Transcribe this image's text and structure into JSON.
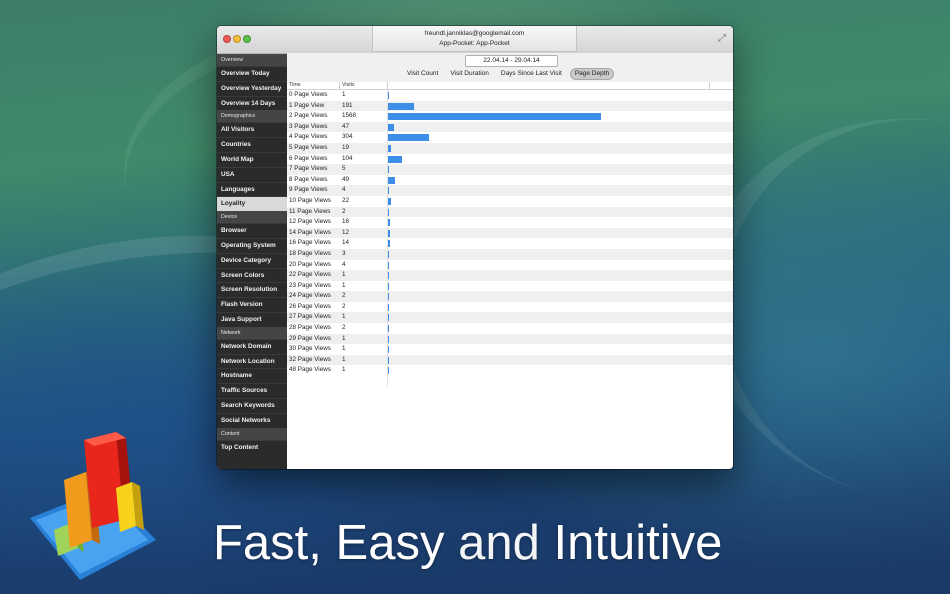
{
  "window": {
    "account": "freundt.janniklas@googlemail.com",
    "app": "App-Pocket: App-Pocket"
  },
  "sidebar": {
    "sections": [
      {
        "title": "Overview",
        "items": [
          "Overview Today",
          "Overview Yesterday",
          "Overview 14 Days"
        ]
      },
      {
        "title": "Demographics",
        "items": [
          "All Visitors",
          "Countries",
          "World Map",
          "USA",
          "Languages",
          "Loyality"
        ]
      },
      {
        "title": "Device",
        "items": [
          "Browser",
          "Operating System",
          "Device Category",
          "Screen Colors",
          "Screen Resolution",
          "Flash Version",
          "Java Support"
        ]
      },
      {
        "title": "Network",
        "items": [
          "Network Domain",
          "Network Location",
          "Hostname",
          "Traffic Sources",
          "Search Keywords",
          "Social Networks"
        ]
      },
      {
        "title": "Content",
        "items": [
          "Top Content"
        ]
      }
    ],
    "selected": "Loyality"
  },
  "toolbar": {
    "date_range": "22.04.14 - 29.04.14",
    "tabs": [
      "Visit Count",
      "Visit Duration",
      "Days Since Last Visit",
      "Page Depth"
    ],
    "active_tab": "Page Depth"
  },
  "table": {
    "columns": [
      "Time",
      "Visits"
    ],
    "max_visits": 1568,
    "rows": [
      {
        "label": "0 Page Views",
        "visits": 1
      },
      {
        "label": "1 Page View",
        "visits": 191
      },
      {
        "label": "2 Page Views",
        "visits": 1568
      },
      {
        "label": "3 Page Views",
        "visits": 47
      },
      {
        "label": "4 Page Views",
        "visits": 304
      },
      {
        "label": "5 Page Views",
        "visits": 19
      },
      {
        "label": "6 Page Views",
        "visits": 104
      },
      {
        "label": "7 Page Views",
        "visits": 5
      },
      {
        "label": "8 Page Views",
        "visits": 49
      },
      {
        "label": "9 Page Views",
        "visits": 4
      },
      {
        "label": "10 Page Views",
        "visits": 22
      },
      {
        "label": "11 Page Views",
        "visits": 2
      },
      {
        "label": "12 Page Views",
        "visits": 16
      },
      {
        "label": "14 Page Views",
        "visits": 12
      },
      {
        "label": "16 Page Views",
        "visits": 14
      },
      {
        "label": "18 Page Views",
        "visits": 3
      },
      {
        "label": "20 Page Views",
        "visits": 4
      },
      {
        "label": "22 Page Views",
        "visits": 1
      },
      {
        "label": "23 Page Views",
        "visits": 1
      },
      {
        "label": "24 Page Views",
        "visits": 2
      },
      {
        "label": "26 Page Views",
        "visits": 2
      },
      {
        "label": "27 Page Views",
        "visits": 1
      },
      {
        "label": "28 Page Views",
        "visits": 2
      },
      {
        "label": "29 Page Views",
        "visits": 1
      },
      {
        "label": "30 Page Views",
        "visits": 1
      },
      {
        "label": "32 Page Views",
        "visits": 1
      },
      {
        "label": "48 Page Views",
        "visits": 1
      }
    ]
  },
  "tagline": {
    "part1": "Fast, Easy",
    "part2": "and",
    "part3": "Intuitive"
  },
  "colors": {
    "bar": "#3c8ee8",
    "sidebar_bg": "#2b2b2c",
    "sidebar_section": "#454547"
  },
  "icons": {
    "app_logo": "bar-chart-logo-icon"
  }
}
